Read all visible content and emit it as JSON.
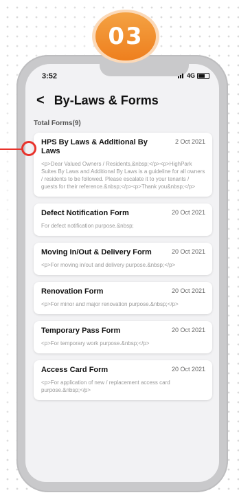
{
  "badge": "03",
  "status": {
    "time": "3:52",
    "network": "4G"
  },
  "header": {
    "back_icon": "chevron-left-icon",
    "back_glyph": "<",
    "title": "By-Laws & Forms"
  },
  "total_label": "Total Forms(9)",
  "forms": [
    {
      "title": "HPS By Laws & Additional By Laws",
      "date": "2 Oct 2021",
      "desc": "<p>Dear Valued Owners / Residents,&nbsp;</p><p>HighPark Suites By Laws and Additional By Laws is a guideline for all owners / residents to be followed. Please escalate it to your tenants / guests for their reference.&nbsp;</p><p>Thank you&nbsp;</p>"
    },
    {
      "title": "Defect Notification Form",
      "date": "20 Oct 2021",
      "desc": "For defect notification purpose.&nbsp;"
    },
    {
      "title": "Moving In/Out & Delivery Form",
      "date": "20 Oct 2021",
      "desc": "<p>For moving in/out and delivery purpose.&nbsp;</p>"
    },
    {
      "title": "Renovation Form",
      "date": "20 Oct 2021",
      "desc": "<p>For minor and major renovation purpose.&nbsp;</p>"
    },
    {
      "title": "Temporary Pass Form",
      "date": "20 Oct 2021",
      "desc": "<p>For temporary work purpose.&nbsp;</p>"
    },
    {
      "title": "Access Card Form",
      "date": "20 Oct 2021",
      "desc": "<p>For application of new / replacement access card purpose.&nbsp;</p>"
    }
  ],
  "colors": {
    "accent": "#ee7f1e",
    "pointer": "#e8322b"
  }
}
